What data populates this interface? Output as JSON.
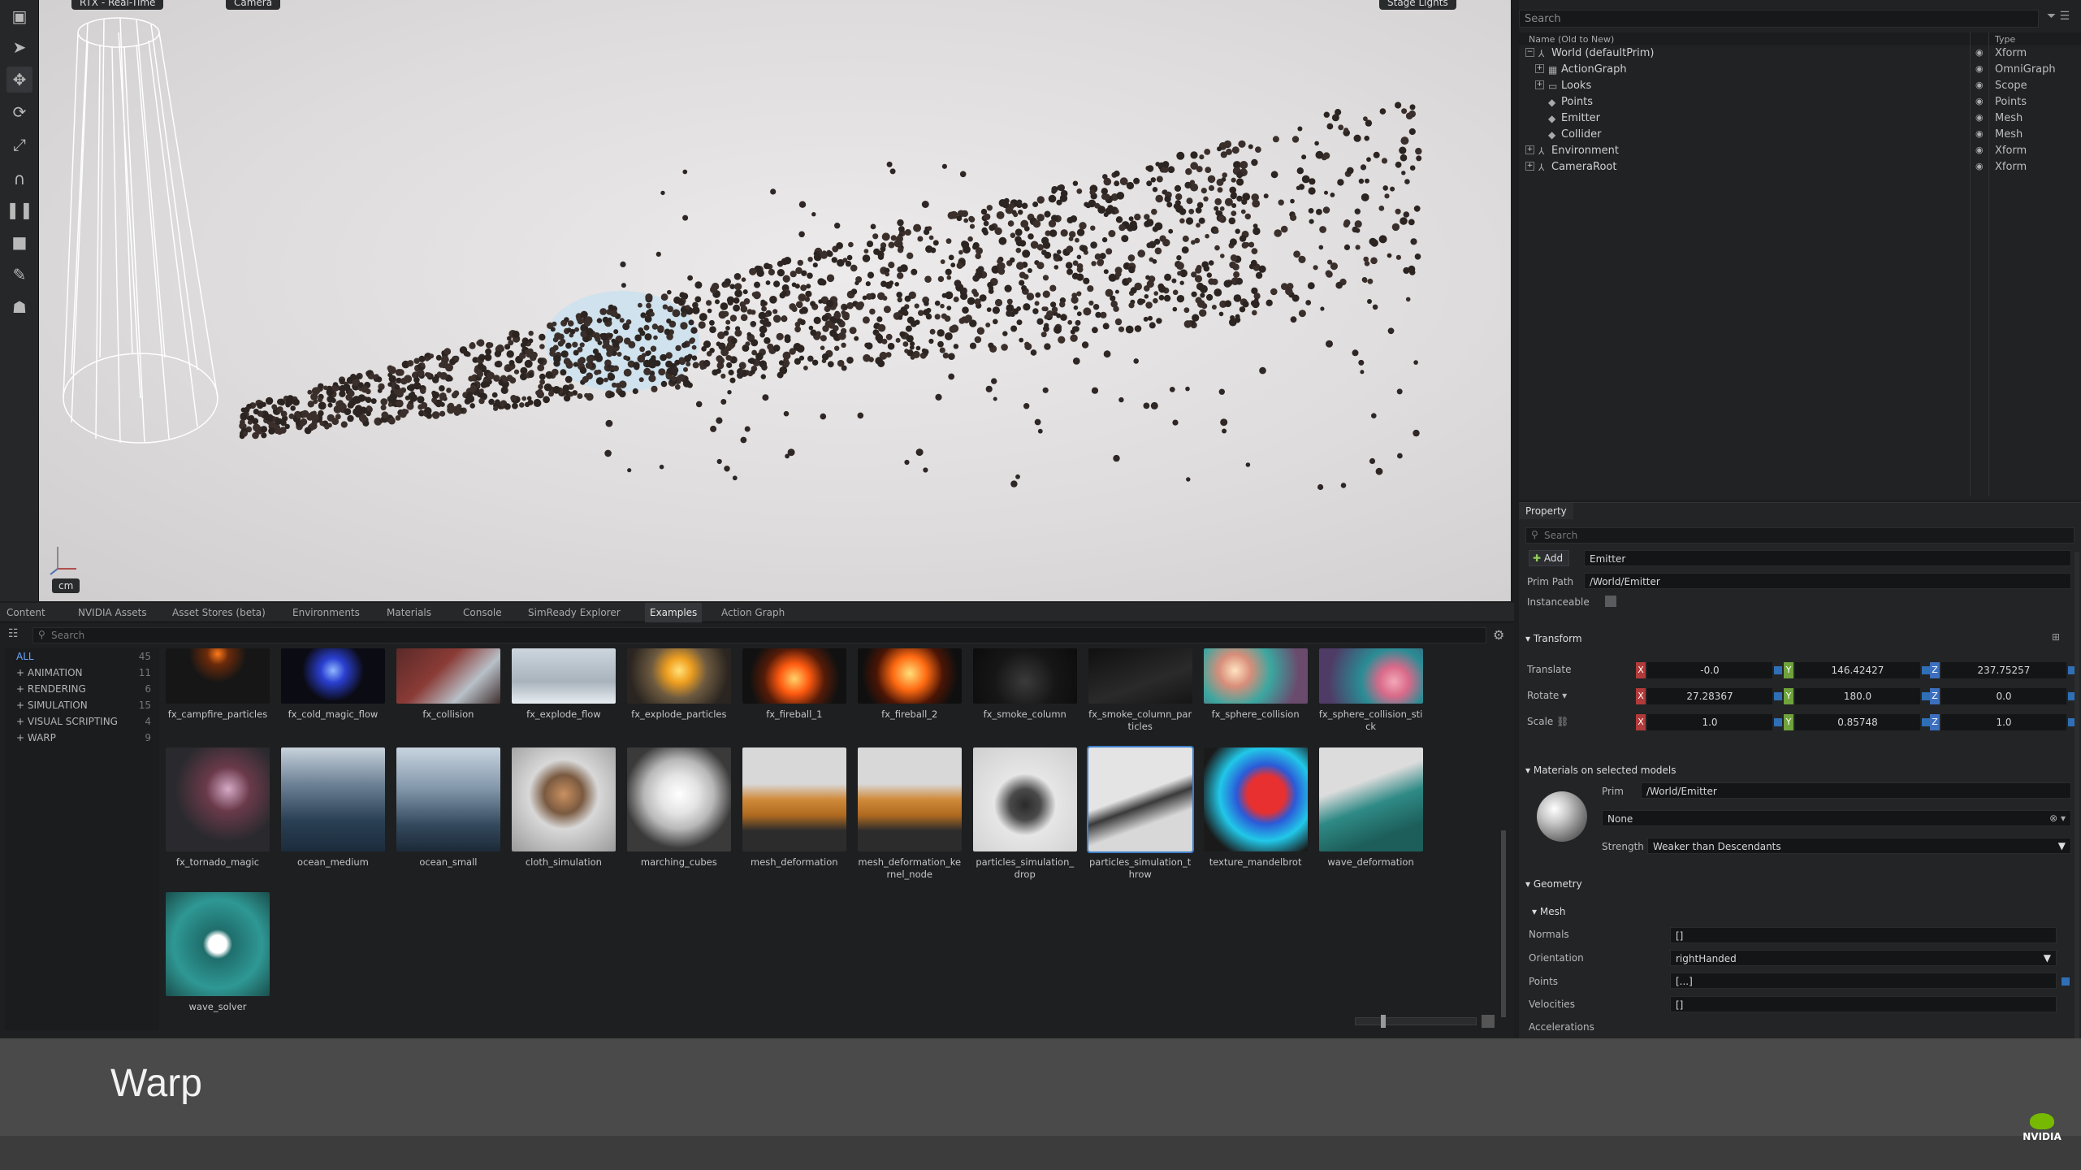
{
  "viewport": {
    "top_chips": [
      "RTX - Real-Time",
      "Camera",
      "Stage Lights"
    ],
    "unit_badge": "cm"
  },
  "stage": {
    "search_placeholder": "Search",
    "col_name": "Name (Old to New)",
    "col_type": "Type",
    "rows": [
      {
        "label": "World (defaultPrim)",
        "type": "Xform",
        "indent": 0,
        "expander": "−",
        "icon": "xform-icon"
      },
      {
        "label": "ActionGraph",
        "type": "OmniGraph",
        "indent": 1,
        "expander": "+",
        "icon": "graph-icon"
      },
      {
        "label": "Looks",
        "type": "Scope",
        "indent": 1,
        "expander": "+",
        "icon": "folder-icon"
      },
      {
        "label": "Points",
        "type": "Points",
        "indent": 1,
        "expander": "",
        "icon": "points-icon"
      },
      {
        "label": "Emitter",
        "type": "Mesh",
        "indent": 1,
        "expander": "",
        "icon": "mesh-icon"
      },
      {
        "label": "Collider",
        "type": "Mesh",
        "indent": 1,
        "expander": "",
        "icon": "mesh-icon"
      },
      {
        "label": "Environment",
        "type": "Xform",
        "indent": 0,
        "expander": "+",
        "icon": "xform-icon"
      },
      {
        "label": "CameraRoot",
        "type": "Xform",
        "indent": 0,
        "expander": "+",
        "icon": "xform-icon"
      }
    ]
  },
  "property": {
    "tab": "Property",
    "search_placeholder": "Search",
    "add_label": "Add",
    "name_value": "Emitter",
    "prim_path_label": "Prim Path",
    "prim_path_value": "/World/Emitter",
    "instanceable_label": "Instanceable",
    "transform_label": "Transform",
    "translate_label": "Translate",
    "rotate_label": "Rotate ▾",
    "scale_label": "Scale",
    "translate": [
      "-0.0",
      "146.42427",
      "237.75257"
    ],
    "rotate": [
      "27.28367",
      "180.0",
      "0.0"
    ],
    "scale": [
      "1.0",
      "0.85748",
      "1.0"
    ],
    "materials_label": "Materials on selected models",
    "mat_prim_label": "Prim",
    "mat_prim_value": "/World/Emitter",
    "mat_value": "None",
    "strength_label": "Strength",
    "strength_value": "Weaker than Descendants",
    "geometry_label": "Geometry",
    "mesh_label": "Mesh",
    "normals_label": "Normals",
    "normals_value": "[]",
    "orientation_label": "Orientation",
    "orientation_value": "rightHanded",
    "points_label": "Points",
    "points_value": "[...]",
    "velocities_label": "Velocities",
    "velocities_value": "[]",
    "accelerations_label": "Accelerations"
  },
  "browser": {
    "tabs": [
      "Content",
      "NVIDIA Assets",
      "Asset Stores (beta)",
      "Environments",
      "Materials",
      "Console",
      "SimReady Explorer",
      "Examples",
      "Action Graph"
    ],
    "active_tab": "Examples",
    "search_placeholder": "Search",
    "categories": [
      {
        "name": "ALL",
        "count": "45"
      },
      {
        "name": "+ ANIMATION",
        "count": "11"
      },
      {
        "name": "+ RENDERING",
        "count": "6"
      },
      {
        "name": "+ SIMULATION",
        "count": "15"
      },
      {
        "name": "+ VISUAL SCRIPTING",
        "count": "4"
      },
      {
        "name": "+ WARP",
        "count": "9"
      }
    ],
    "row1": [
      "fx_campfire_particles",
      "fx_cold_magic_flow",
      "fx_collision",
      "fx_explode_flow",
      "fx_explode_particles",
      "fx_fireball_1",
      "fx_fireball_2",
      "fx_smoke_column",
      "fx_smoke_column_particles",
      "fx_sphere_collision",
      "fx_sphere_collision_stick"
    ],
    "row2": [
      "fx_tornado_magic",
      "ocean_medium",
      "ocean_small",
      "cloth_simulation",
      "marching_cubes",
      "mesh_deformation",
      "mesh_deformation_kernel_node",
      "particles_simulation_drop",
      "particles_simulation_throw",
      "texture_mandelbrot",
      "wave_deformation"
    ],
    "row3": [
      "wave_solver"
    ]
  },
  "caption": "Warp",
  "brand": "NVIDIA"
}
